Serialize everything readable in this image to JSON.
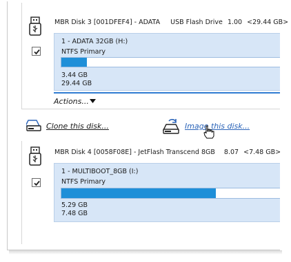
{
  "disks": [
    {
      "header": {
        "name": "MBR Disk 3 [001DFEF4] - ADATA",
        "type": "USB Flash Drive",
        "version": "1.00",
        "capacity": "<29.44 GB>"
      },
      "selected": true,
      "partition": {
        "title": "1 - ADATA 32GB (H:)",
        "filesystem": "NTFS Primary",
        "used": "3.44 GB",
        "total": "29.44 GB",
        "used_fraction": 0.117
      }
    },
    {
      "header": {
        "name": "MBR Disk 4 [0058F08E] - JetFlash Transcend 8GB",
        "version": "8.07",
        "capacity": "<7.48 GB>"
      },
      "selected": true,
      "partition": {
        "title": "1 - MULTIBOOT_8GB (I:)",
        "filesystem": "NTFS Primary",
        "used": "5.29 GB",
        "total": "7.48 GB",
        "used_fraction": 0.707
      }
    }
  ],
  "actions_label": "Actions...",
  "clone_link": "Clone this disk...",
  "image_link": "Image this disk...",
  "colors": {
    "panel_bg": "#d7e6f7",
    "bar_fill": "#1f8fd8",
    "accent_rule": "#2e7bd1",
    "link_blue": "#2a63b8"
  },
  "icons": [
    "usb-drive-icon",
    "checkbox-check-icon",
    "clone-disk-icon",
    "image-disk-icon",
    "hand-cursor-icon",
    "dropdown-arrow-icon"
  ]
}
